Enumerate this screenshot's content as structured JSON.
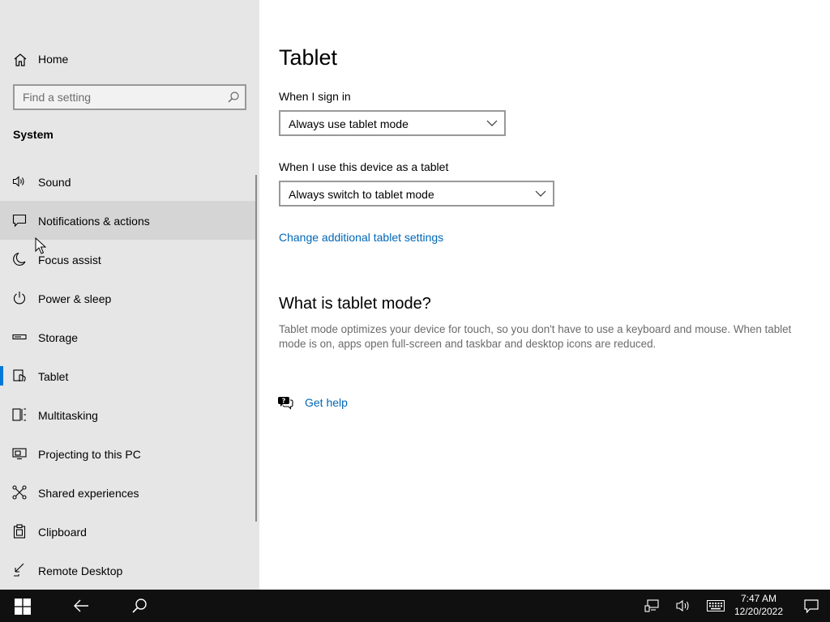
{
  "sidebar": {
    "home_label": "Home",
    "search_placeholder": "Find a setting",
    "section_title": "System",
    "items": [
      {
        "label": "Sound",
        "icon": "speaker-icon"
      },
      {
        "label": "Notifications & actions",
        "icon": "notification-icon",
        "state": "hover"
      },
      {
        "label": "Focus assist",
        "icon": "moon-icon"
      },
      {
        "label": "Power & sleep",
        "icon": "power-icon"
      },
      {
        "label": "Storage",
        "icon": "storage-icon"
      },
      {
        "label": "Tablet",
        "icon": "tablet-icon",
        "state": "selected"
      },
      {
        "label": "Multitasking",
        "icon": "multitasking-icon"
      },
      {
        "label": "Projecting to this PC",
        "icon": "projecting-icon"
      },
      {
        "label": "Shared experiences",
        "icon": "shared-icon"
      },
      {
        "label": "Clipboard",
        "icon": "clipboard-icon"
      },
      {
        "label": "Remote Desktop",
        "icon": "remote-desktop-icon"
      }
    ]
  },
  "main": {
    "title": "Tablet",
    "sign_in": {
      "label": "When I sign in",
      "value": "Always use tablet mode"
    },
    "device_as_tablet": {
      "label": "When I use this device as a tablet",
      "value": "Always switch to tablet mode"
    },
    "additional_link": "Change additional tablet settings",
    "what_heading": "What is tablet mode?",
    "description": "Tablet mode optimizes your device for touch, so you don't have to use a keyboard and mouse. When tablet mode is on, apps open full-screen and taskbar and desktop icons are reduced.",
    "help_link": "Get help"
  },
  "taskbar": {
    "time": "7:47 AM",
    "date": "12/20/2022"
  },
  "colors": {
    "accent": "#0078d7",
    "link": "#0067b8",
    "sidebar_bg": "#e6e6e6",
    "taskbar_bg": "#101010"
  }
}
